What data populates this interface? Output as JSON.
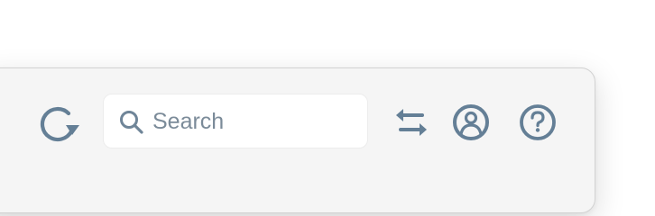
{
  "toolbar": {
    "search": {
      "placeholder": "Search",
      "value": ""
    },
    "icons": {
      "refresh": "refresh-icon",
      "search": "search-icon",
      "swap": "swap-icon",
      "account": "account-icon",
      "help": "help-icon"
    }
  },
  "colors": {
    "icon": "#647f96",
    "placeholder": "#7b8b99",
    "background": "#f5f5f5",
    "search_background": "#ffffff"
  }
}
